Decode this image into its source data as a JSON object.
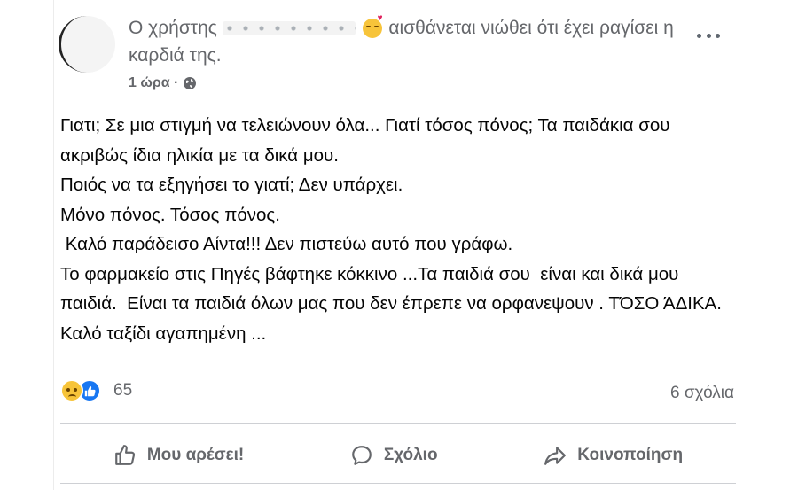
{
  "post": {
    "header": {
      "prefix": "Ο χρήστης",
      "suffix": "αισθάνεται νιώθει ότι έχει ραγίσει η καρδιά της."
    },
    "time": "1 ώρα ·",
    "body_lines": [
      "Γιατι; Σε μια στιγμή να τελειώνουν όλα... Γιατί τόσος πόνος; Τα παιδάκια σου ακριβώς ίδια ηλικία με τα δικά μου.",
      "Ποιός να τα εξηγήσει το γιατί; Δεν υπάρχει.",
      "Μόνο πόνος. Τόσος πόνος.",
      " Καλό παράδεισο Αίντα!!! Δεν πιστεύω αυτό που γράφω.",
      "Το φαρμακείο στις Πηγές βάφτηκε κόκκινο ...Τα παιδιά σου  είναι και δικά μου παιδιά.  Είναι τα παιδιά όλων μας που δεν έπρεπε να ορφανεψουν . ΤΌΣΟ ΆΔΙΚΑ.",
      "Καλό ταξίδι αγαπημένη ..."
    ],
    "reactions": {
      "icons": [
        "sad-reaction-icon",
        "like-reaction-icon"
      ],
      "count": "65"
    },
    "comments_label": "6 σχόλια",
    "actions": {
      "like": "Μου αρέσει!",
      "comment": "Σχόλιο",
      "share": "Κοινοποίηση"
    }
  },
  "colors": {
    "secondary_text": "#65676b",
    "primary_text": "#050505",
    "like_blue": "#1877f2",
    "divider": "#ced0d4"
  }
}
